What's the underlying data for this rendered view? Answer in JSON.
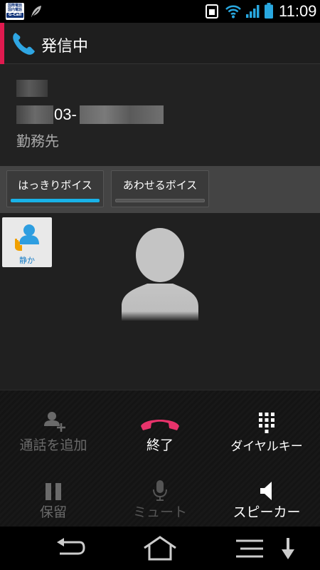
{
  "status_bar": {
    "app_logo_line1": "国際電話",
    "app_logo_line2": "国内電話",
    "app_logo_brand": "G-Call",
    "time": "11:09",
    "icons": [
      "g-call-app-icon",
      "leaf-icon",
      "sim-icon",
      "wifi-icon",
      "signal-icon",
      "battery-icon"
    ]
  },
  "header": {
    "title": "発信中",
    "accent_color": "#e01a4f",
    "icon": "phone-handset-icon"
  },
  "contact": {
    "number_visible_part": "03-",
    "label": "勤務先"
  },
  "voice_tabs": [
    {
      "label": "はっきりボイス",
      "active": true
    },
    {
      "label": "あわせるボイス",
      "active": false
    }
  ],
  "voice_accent_color": "#19b2e8",
  "quiet_button": {
    "label": "静か",
    "icon": "quiet-person-icon"
  },
  "controls": {
    "add_call": "通話を追加",
    "end_call": "終了",
    "dialpad": "ダイヤルキー",
    "hold": "保留",
    "mute": "ミュート",
    "speaker": "スピーカー"
  },
  "end_call_color": "#e8336b",
  "nav": [
    "back-icon",
    "home-icon",
    "menu-icon",
    "arrow-down-icon"
  ]
}
